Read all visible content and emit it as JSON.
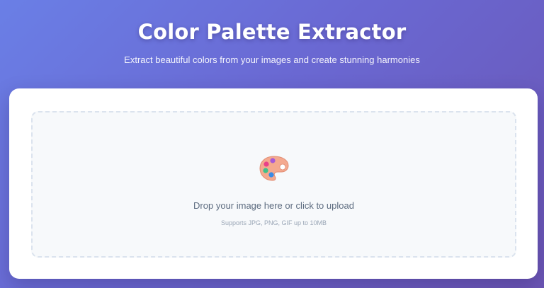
{
  "header": {
    "title": "Color Palette Extractor",
    "subtitle": "Extract beautiful colors from your images and create stunning harmonies"
  },
  "upload": {
    "icon": "artist-palette-icon",
    "prompt": "Drop your image here or click to upload",
    "supported_formats": "Supports JPG, PNG, GIF up to 10MB"
  },
  "colors": {
    "background_start": "#6a7fe6",
    "background_end": "#6b55b4",
    "card": "#ffffff",
    "dropzone_bg": "#f7f9fb",
    "dropzone_border": "#dbe3ee",
    "palette_body": "#f4a98f",
    "palette_dot_pink": "#e8418a",
    "palette_dot_purple": "#a65ad6",
    "palette_dot_green": "#3fc08a",
    "palette_dot_blue": "#3a8be6"
  }
}
